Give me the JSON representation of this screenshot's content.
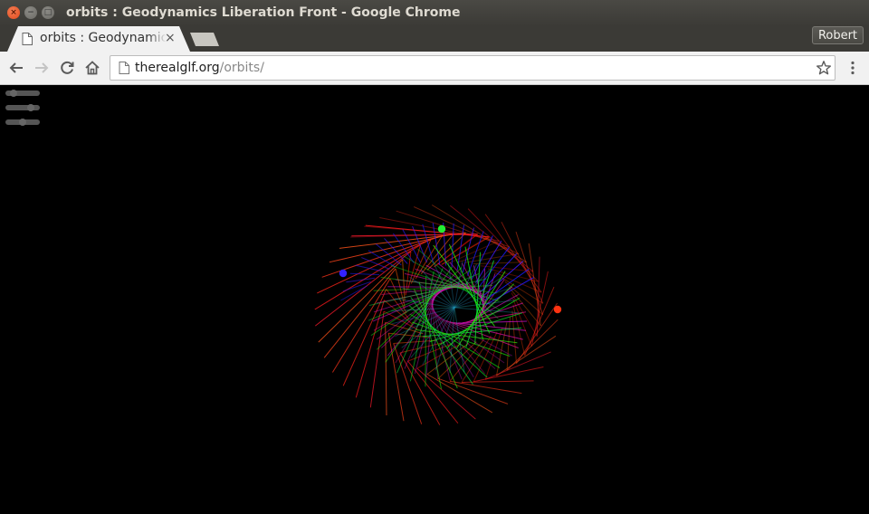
{
  "window": {
    "title": "orbits : Geodynamics Liberation Front - Google Chrome",
    "close_glyph": "×",
    "minimize_glyph": "−",
    "maximize_glyph": "□"
  },
  "tab": {
    "title": "orbits : Geodynamics Liberation Front",
    "close_glyph": "×"
  },
  "profile": {
    "name": "Robert"
  },
  "toolbar": {
    "icons": [
      "back-icon",
      "forward-icon",
      "reload-icon",
      "home-icon",
      "bookmark-star-icon",
      "menu-icon"
    ]
  },
  "address": {
    "host": "therealglf.org",
    "path": "/orbits/"
  },
  "controls": {
    "sliders": [
      {
        "name": "slider-1",
        "value": 0.15
      },
      {
        "name": "slider-2",
        "value": 0.8
      },
      {
        "name": "slider-3",
        "value": 0.5
      }
    ]
  },
  "scene": {
    "bodies": [
      {
        "name": "blue-body",
        "color": "#3322ff"
      },
      {
        "name": "green-body",
        "color": "#22ee33"
      },
      {
        "name": "red-body",
        "color": "#ff3311"
      }
    ],
    "background": "#000000"
  }
}
